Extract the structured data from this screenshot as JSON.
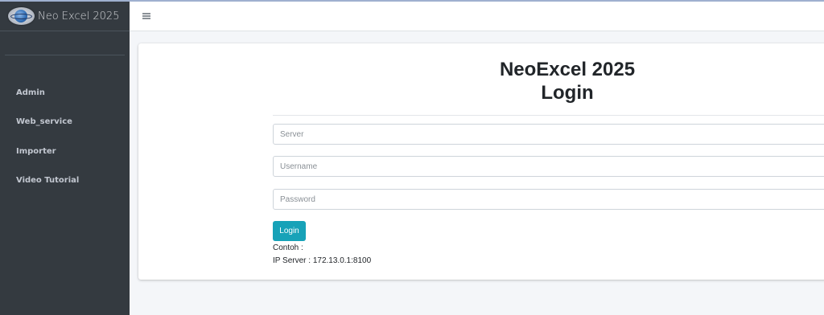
{
  "brand": {
    "name": "Neo Excel 2025",
    "logo_icon": "neo-excel-globe-logo"
  },
  "sidebar": {
    "items": [
      {
        "label": "Admin"
      },
      {
        "label": "Web_service"
      },
      {
        "label": "Importer"
      },
      {
        "label": "Video Tutorial"
      }
    ]
  },
  "navbar": {
    "menu_icon": "hamburger-menu-icon"
  },
  "login": {
    "title_line1": "NeoExcel 2025",
    "title_line2": "Login",
    "server_placeholder": "Server",
    "username_placeholder": "Username",
    "password_placeholder": "Password",
    "button_label": "Login",
    "hint_label": "Contoh :",
    "hint_example": "IP Server : 172.13.0.1:8100"
  },
  "colors": {
    "sidebar_bg": "#343a40",
    "button_bg": "#17a2b8",
    "page_bg": "#f4f6f9"
  }
}
